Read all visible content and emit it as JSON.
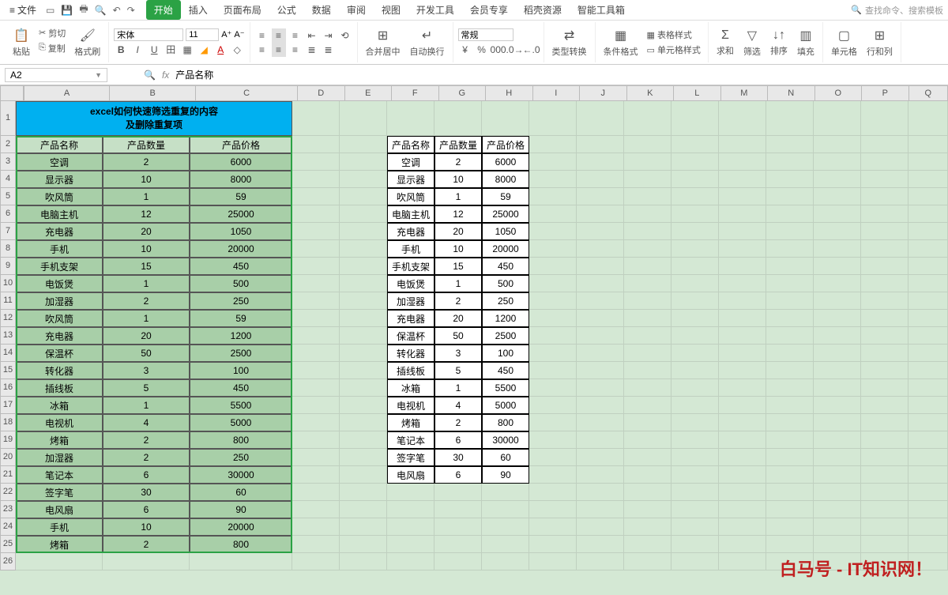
{
  "menu": {
    "file": "文件",
    "tabs": [
      "开始",
      "插入",
      "页面布局",
      "公式",
      "数据",
      "审阅",
      "视图",
      "开发工具",
      "会员专享",
      "稻壳资源",
      "智能工具箱"
    ],
    "activeTab": 0,
    "searchPlaceholder": "查找命令、搜索模板"
  },
  "ribbon": {
    "paste": "粘贴",
    "cut": "剪切",
    "copy": "复制",
    "formatPainter": "格式刷",
    "fontName": "宋体",
    "fontSize": "11",
    "mergeCenter": "合并居中",
    "wrapText": "自动换行",
    "numberFormat": "常规",
    "typeConvert": "类型转换",
    "condFormat": "条件格式",
    "tableStyle": "表格样式",
    "cellStyle": "单元格样式",
    "sum": "求和",
    "filter": "筛选",
    "sort": "排序",
    "fill": "填充",
    "cell": "单元格",
    "rowCol": "行和列"
  },
  "formulaBar": {
    "nameBox": "A2",
    "formula": "产品名称"
  },
  "colWidths": {
    "A": 110,
    "B": 110,
    "C": 130,
    "D": 60,
    "E": 60,
    "F": 60,
    "G": 60,
    "H": 60,
    "I": 60,
    "J": 60,
    "K": 60,
    "L": 60,
    "M": 60,
    "N": 60,
    "O": 60,
    "P": 60,
    "Q": 50
  },
  "columns": [
    "A",
    "B",
    "C",
    "D",
    "E",
    "F",
    "G",
    "H",
    "I",
    "J",
    "K",
    "L",
    "M",
    "N",
    "O",
    "P",
    "Q"
  ],
  "titleText": "excel如何快速筛选重复的内容\n及删除重复项",
  "table1": {
    "headers": [
      "产品名称",
      "产品数量",
      "产品价格"
    ],
    "rows": [
      [
        "空调",
        "2",
        "6000"
      ],
      [
        "显示器",
        "10",
        "8000"
      ],
      [
        "吹风筒",
        "1",
        "59"
      ],
      [
        "电脑主机",
        "12",
        "25000"
      ],
      [
        "充电器",
        "20",
        "1050"
      ],
      [
        "手机",
        "10",
        "20000"
      ],
      [
        "手机支架",
        "15",
        "450"
      ],
      [
        "电饭煲",
        "1",
        "500"
      ],
      [
        "加湿器",
        "2",
        "250"
      ],
      [
        "吹风筒",
        "1",
        "59"
      ],
      [
        "充电器",
        "20",
        "1200"
      ],
      [
        "保温杯",
        "50",
        "2500"
      ],
      [
        "转化器",
        "3",
        "100"
      ],
      [
        "插线板",
        "5",
        "450"
      ],
      [
        "冰箱",
        "1",
        "5500"
      ],
      [
        "电视机",
        "4",
        "5000"
      ],
      [
        "烤箱",
        "2",
        "800"
      ],
      [
        "加湿器",
        "2",
        "250"
      ],
      [
        "笔记本",
        "6",
        "30000"
      ],
      [
        "签字笔",
        "30",
        "60"
      ],
      [
        "电风扇",
        "6",
        "90"
      ],
      [
        "手机",
        "10",
        "20000"
      ],
      [
        "烤箱",
        "2",
        "800"
      ]
    ]
  },
  "table2": {
    "headers": [
      "产品名称",
      "产品数量",
      "产品价格"
    ],
    "rows": [
      [
        "空调",
        "2",
        "6000"
      ],
      [
        "显示器",
        "10",
        "8000"
      ],
      [
        "吹风筒",
        "1",
        "59"
      ],
      [
        "电脑主机",
        "12",
        "25000"
      ],
      [
        "充电器",
        "20",
        "1050"
      ],
      [
        "手机",
        "10",
        "20000"
      ],
      [
        "手机支架",
        "15",
        "450"
      ],
      [
        "电饭煲",
        "1",
        "500"
      ],
      [
        "加湿器",
        "2",
        "250"
      ],
      [
        "充电器",
        "20",
        "1200"
      ],
      [
        "保温杯",
        "50",
        "2500"
      ],
      [
        "转化器",
        "3",
        "100"
      ],
      [
        "插线板",
        "5",
        "450"
      ],
      [
        "冰箱",
        "1",
        "5500"
      ],
      [
        "电视机",
        "4",
        "5000"
      ],
      [
        "烤箱",
        "2",
        "800"
      ],
      [
        "笔记本",
        "6",
        "30000"
      ],
      [
        "签字笔",
        "30",
        "60"
      ],
      [
        "电风扇",
        "6",
        "90"
      ]
    ]
  },
  "watermark": "白马号 - IT知识网！",
  "rowCount": 26
}
